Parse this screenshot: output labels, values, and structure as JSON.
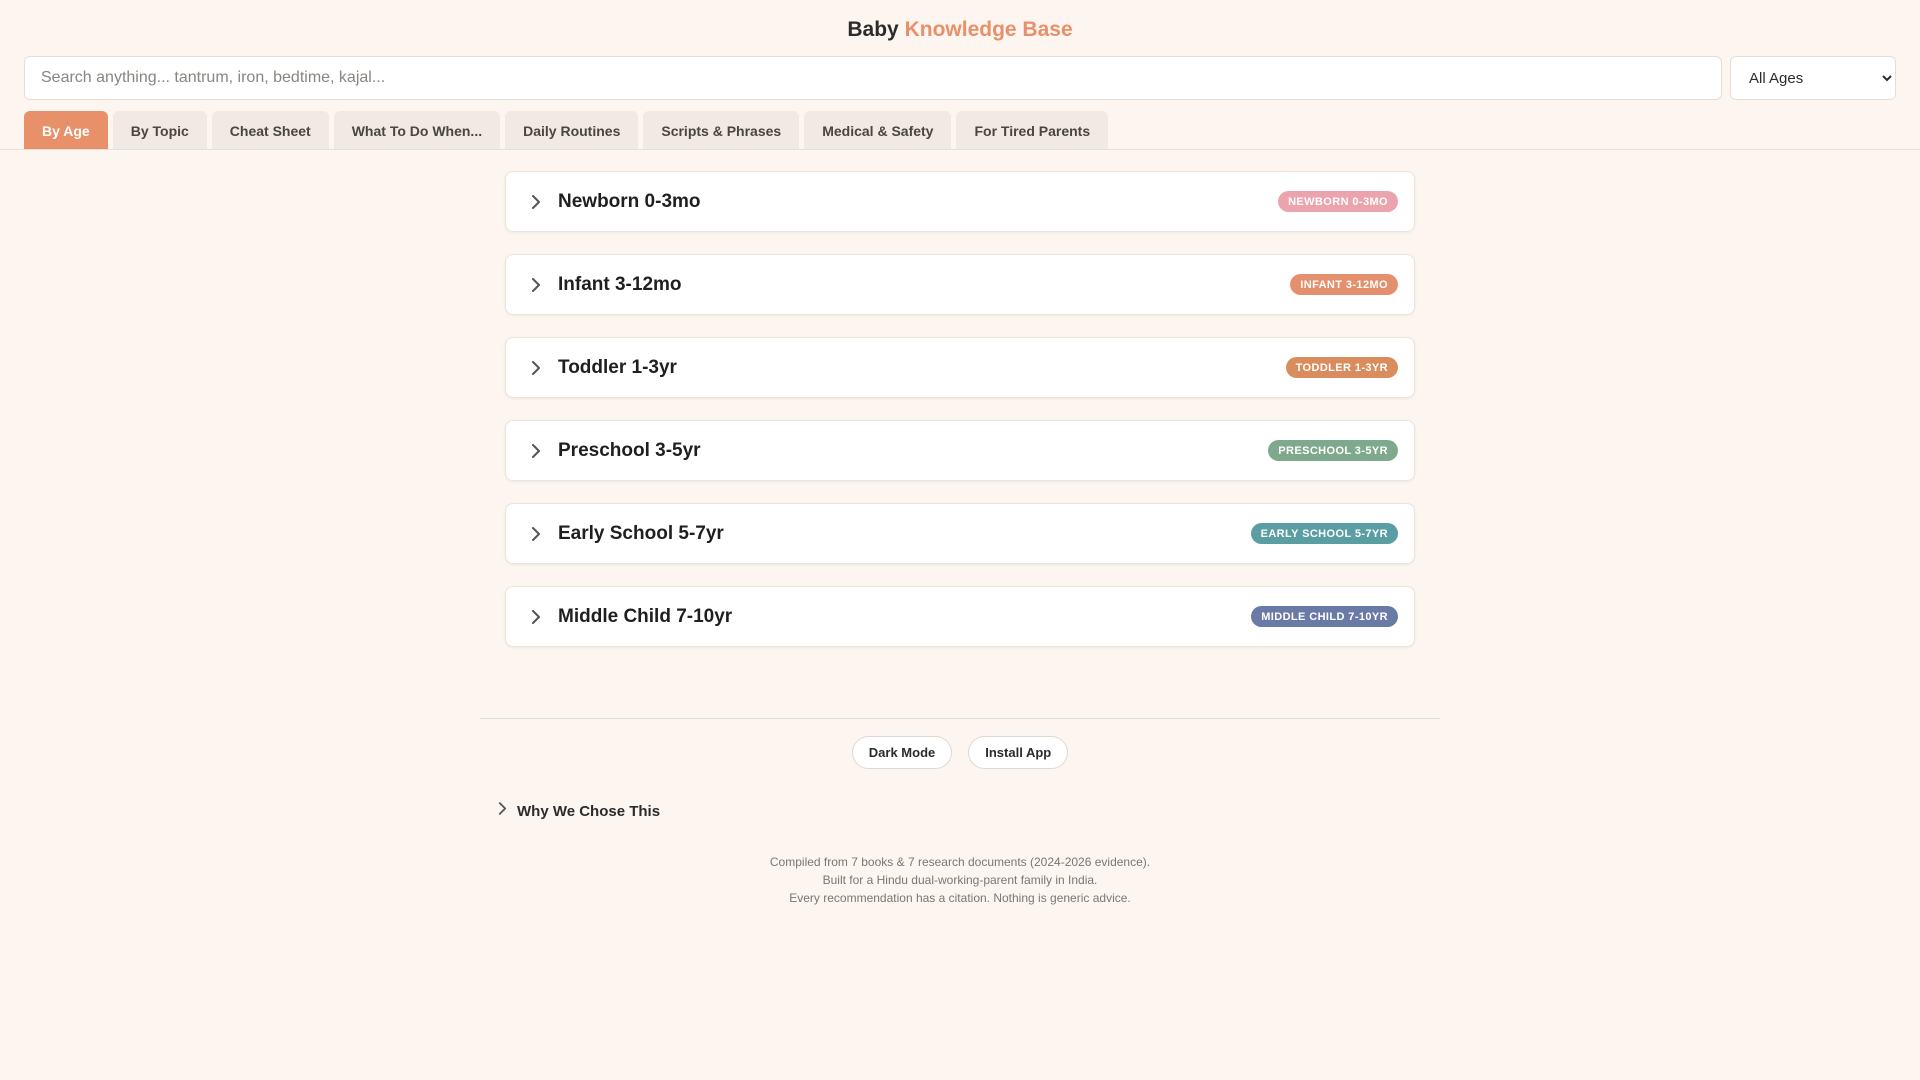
{
  "header": {
    "title_main": "Baby",
    "title_accent": "Knowledge Base"
  },
  "search": {
    "placeholder": "Search anything... tantrum, iron, bedtime, kajal...",
    "value": "",
    "age_filter": "All Ages"
  },
  "tabs": [
    {
      "label": "By Age",
      "active": true
    },
    {
      "label": "By Topic",
      "active": false
    },
    {
      "label": "Cheat Sheet",
      "active": false
    },
    {
      "label": "What To Do When...",
      "active": false
    },
    {
      "label": "Daily Routines",
      "active": false
    },
    {
      "label": "Scripts & Phrases",
      "active": false
    },
    {
      "label": "Medical & Safety",
      "active": false
    },
    {
      "label": "For Tired Parents",
      "active": false
    }
  ],
  "age_groups": [
    {
      "title": "Newborn 0-3mo",
      "badge": "NEWBORN 0-3MO",
      "color": "#eba3ae"
    },
    {
      "title": "Infant 3-12mo",
      "badge": "INFANT 3-12MO",
      "color": "#e48f6e"
    },
    {
      "title": "Toddler 1-3yr",
      "badge": "TODDLER 1-3YR",
      "color": "#d98d5e"
    },
    {
      "title": "Preschool 3-5yr",
      "badge": "PRESCHOOL 3-5YR",
      "color": "#7fa98c"
    },
    {
      "title": "Early School 5-7yr",
      "badge": "EARLY SCHOOL 5-7YR",
      "color": "#5a9ea4"
    },
    {
      "title": "Middle Child 7-10yr",
      "badge": "MIDDLE CHILD 7-10YR",
      "color": "#6a7aa6"
    }
  ],
  "footer": {
    "dark_mode_label": "Dark Mode",
    "install_label": "Install App",
    "why_label": "Why We Chose This",
    "credits": [
      "Compiled from 7 books & 7 research documents (2024-2026 evidence).",
      "Built for a Hindu dual-working-parent family in India.",
      "Every recommendation has a citation. Nothing is generic advice."
    ]
  },
  "colors": {
    "accent": "#e8906a",
    "background": "#fdf6f0"
  }
}
